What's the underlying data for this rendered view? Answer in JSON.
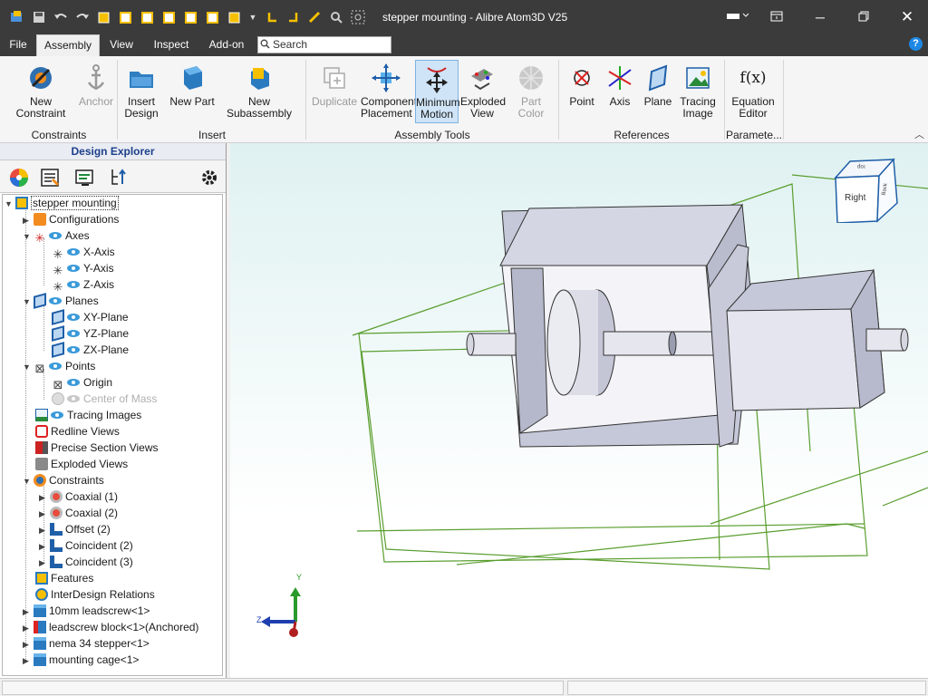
{
  "window": {
    "title": "stepper mounting - Alibre Atom3D V25",
    "min_icon": "minimize-icon",
    "max_icon": "restore-icon",
    "close_icon": "close-icon"
  },
  "menu": {
    "tabs": [
      "File",
      "Assembly",
      "View",
      "Inspect",
      "Add-on"
    ],
    "active_tab": "Assembly",
    "search_placeholder": "Search",
    "help": "?"
  },
  "ribbon": {
    "buttons": [
      {
        "label": "New Constraint",
        "icon": "new-constraint-icon"
      },
      {
        "label": "Anchor",
        "icon": "anchor-icon",
        "disabled": true
      },
      {
        "label": "Insert Design",
        "icon": "insert-design-icon"
      },
      {
        "label": "New Part",
        "icon": "new-part-icon"
      },
      {
        "label": "New Subassembly",
        "icon": "new-subassembly-icon"
      },
      {
        "label": "Duplicate",
        "icon": "duplicate-icon",
        "disabled": true
      },
      {
        "label": "Component Placement",
        "icon": "component-placement-icon"
      },
      {
        "label": "Minimum Motion",
        "icon": "minimum-motion-icon",
        "selected": true
      },
      {
        "label": "Exploded View",
        "icon": "exploded-view-icon"
      },
      {
        "label": "Part Color",
        "icon": "part-color-icon",
        "disabled": true
      },
      {
        "label": "Point",
        "icon": "point-icon"
      },
      {
        "label": "Axis",
        "icon": "axis-icon"
      },
      {
        "label": "Plane",
        "icon": "plane-icon"
      },
      {
        "label": "Tracing Image",
        "icon": "tracing-image-icon"
      },
      {
        "label": "Equation Editor",
        "icon": "equation-editor-icon"
      }
    ],
    "groups": [
      "Constraints",
      "Insert",
      "Assembly Tools",
      "References",
      "Paramete..."
    ]
  },
  "explorer": {
    "title": "Design Explorer",
    "tree": [
      {
        "label": "stepper mounting",
        "icon": "assembly-icon"
      },
      {
        "label": "Configurations",
        "icon": "configurations-icon"
      },
      {
        "label": "Axes",
        "icon": "axes-icon"
      },
      {
        "label": "X-Axis",
        "icon": "axis-item-icon"
      },
      {
        "label": "Y-Axis",
        "icon": "axis-item-icon"
      },
      {
        "label": "Z-Axis",
        "icon": "axis-item-icon"
      },
      {
        "label": "Planes",
        "icon": "planes-icon"
      },
      {
        "label": "XY-Plane",
        "icon": "plane-item-icon"
      },
      {
        "label": "YZ-Plane",
        "icon": "plane-item-icon"
      },
      {
        "label": "ZX-Plane",
        "icon": "plane-item-icon"
      },
      {
        "label": "Points",
        "icon": "points-icon"
      },
      {
        "label": "Origin",
        "icon": "origin-icon"
      },
      {
        "label": "Center of Mass",
        "icon": "center-of-mass-icon"
      },
      {
        "label": "Tracing Images",
        "icon": "tracing-images-icon"
      },
      {
        "label": "Redline Views",
        "icon": "redline-views-icon"
      },
      {
        "label": "Precise Section Views",
        "icon": "section-views-icon"
      },
      {
        "label": "Exploded Views",
        "icon": "exploded-views-icon"
      },
      {
        "label": "Constraints",
        "icon": "constraints-icon"
      },
      {
        "label": "Coaxial (1)",
        "icon": "coaxial-icon"
      },
      {
        "label": "Coaxial (2)",
        "icon": "coaxial-icon"
      },
      {
        "label": "Offset (2)",
        "icon": "offset-icon"
      },
      {
        "label": "Coincident (2)",
        "icon": "coincident-icon"
      },
      {
        "label": "Coincident (3)",
        "icon": "coincident-icon"
      },
      {
        "label": "Features",
        "icon": "features-icon"
      },
      {
        "label": "InterDesign Relations",
        "icon": "interdesign-icon"
      },
      {
        "label": "10mm leadscrew<1>",
        "icon": "part-icon"
      },
      {
        "label": "leadscrew block<1>(Anchored)",
        "icon": "anchored-part-icon"
      },
      {
        "label": "nema 34 stepper<1>",
        "icon": "part-icon"
      },
      {
        "label": "mounting cage<1>",
        "icon": "part-icon"
      }
    ]
  },
  "viewport": {
    "view_cube": {
      "front": "Right",
      "top": "Top",
      "side": "Back"
    },
    "axes": {
      "y": "Y",
      "z": "Z"
    }
  },
  "colors": {
    "titlebar": "#3b3b3b",
    "accent": "#1c3f8a",
    "selection": "#cfe4f7",
    "plane": "#5a9e2f"
  }
}
